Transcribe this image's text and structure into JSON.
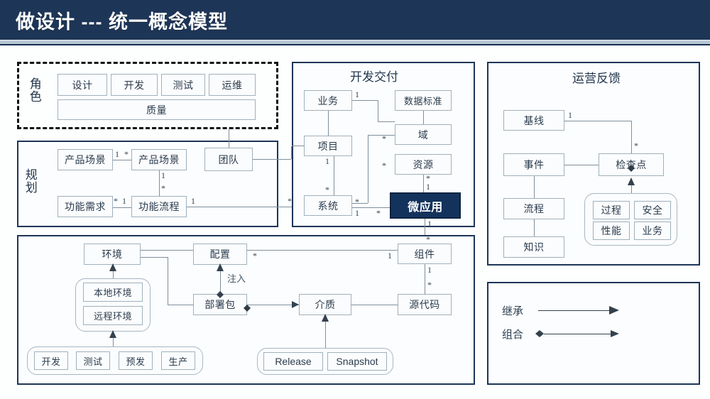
{
  "header": {
    "title": "做设计 --- 统一概念模型",
    "bg_color": "#1d3557",
    "text_color": "#ffffff"
  },
  "panels": {
    "role": {
      "label": "角色",
      "style": "dashed"
    },
    "planning": {
      "label": "规划",
      "style": "solid"
    },
    "dev_delivery": {
      "title": "开发交付",
      "style": "solid"
    },
    "ops_feedback": {
      "title": "运营反馈",
      "style": "solid"
    },
    "environment": {
      "title": "",
      "style": "solid"
    },
    "legend": {
      "title": "",
      "style": "solid"
    }
  },
  "role_nodes": [
    {
      "label": "设计"
    },
    {
      "label": "开发"
    },
    {
      "label": "测试"
    },
    {
      "label": "运维"
    },
    {
      "label": "质量"
    }
  ],
  "planning_nodes": [
    {
      "label": "产品场景"
    },
    {
      "label": "产品场景"
    },
    {
      "label": "团队"
    },
    {
      "label": "功能需求"
    },
    {
      "label": "功能流程"
    }
  ],
  "dev_nodes": [
    {
      "label": "业务"
    },
    {
      "label": "数据标准"
    },
    {
      "label": "项目"
    },
    {
      "label": "域"
    },
    {
      "label": "资源"
    },
    {
      "label": "系统"
    },
    {
      "label": "微应用",
      "highlight": true,
      "color": "#14335c"
    },
    {
      "label": "组件"
    },
    {
      "label": "源代码"
    },
    {
      "label": "介质"
    }
  ],
  "env_nodes": [
    {
      "label": "环境"
    },
    {
      "label": "配置"
    },
    {
      "label": "部署包"
    },
    {
      "label": "本地环境"
    },
    {
      "label": "远程环境"
    },
    {
      "label": "开发"
    },
    {
      "label": "测试"
    },
    {
      "label": "预发"
    },
    {
      "label": "生产"
    },
    {
      "label": "Release"
    },
    {
      "label": "Snapshot"
    }
  ],
  "ops_nodes": [
    {
      "label": "基线"
    },
    {
      "label": "事件"
    },
    {
      "label": "检查点"
    },
    {
      "label": "流程"
    },
    {
      "label": "知识"
    },
    {
      "label": "过程"
    },
    {
      "label": "安全"
    },
    {
      "label": "性能"
    },
    {
      "label": "业务"
    }
  ],
  "edge_labels": [
    {
      "text": "注入"
    }
  ],
  "multiplicities": {
    "one": "1",
    "many": "*"
  },
  "legend": {
    "items": [
      {
        "label": "继承",
        "arrow": "open-arrow"
      },
      {
        "label": "组合",
        "arrow": "diamond-arrow"
      }
    ]
  }
}
